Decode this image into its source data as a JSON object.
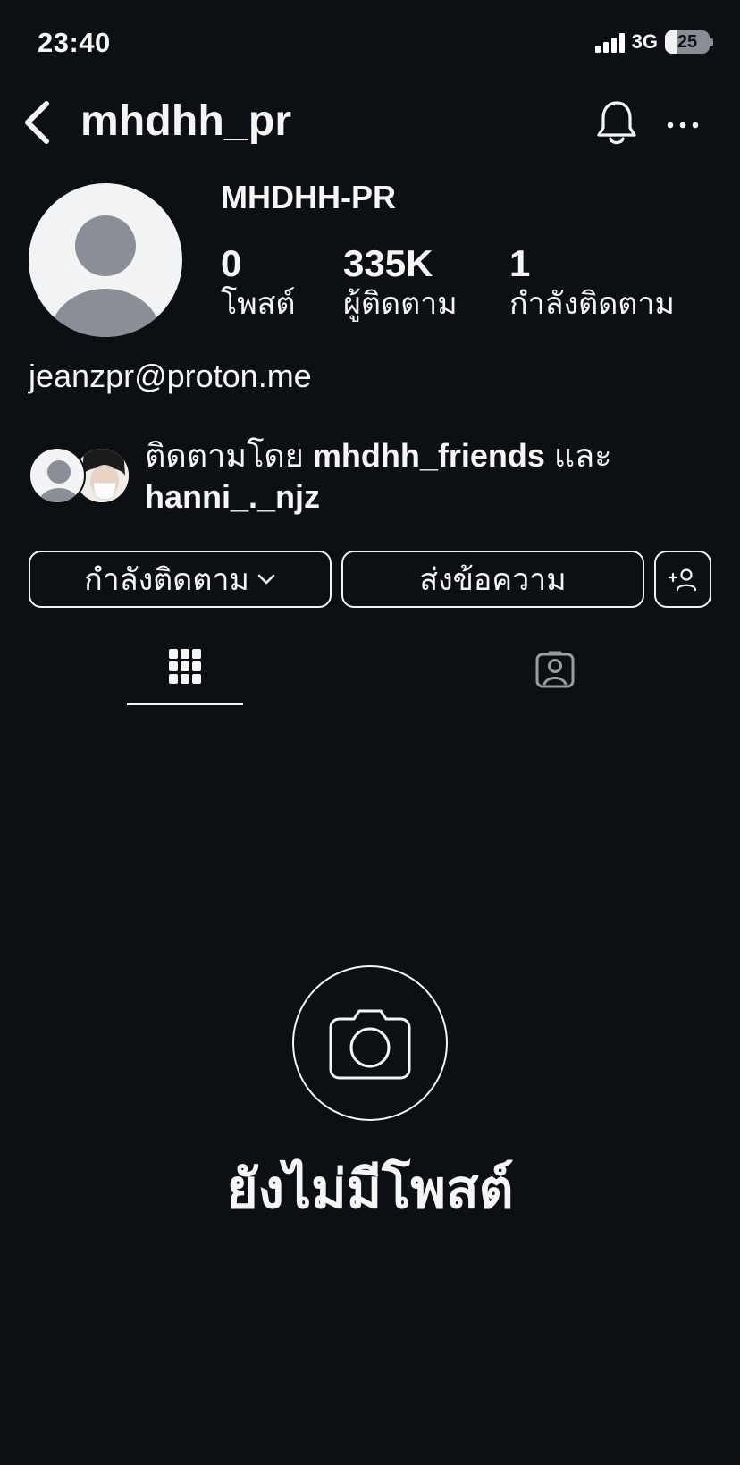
{
  "status_bar": {
    "time": "23:40",
    "network": "3G",
    "battery_level": "25",
    "battery_fraction": 0.25
  },
  "header": {
    "username": "mhdhh_pr",
    "back_icon": "chevron-left-icon",
    "bell_icon": "bell-icon",
    "more_icon": "more-horizontal-icon"
  },
  "profile": {
    "display_name": "MHDHH-PR",
    "stats": [
      {
        "value": "0",
        "label": "โพสต์"
      },
      {
        "value": "335K",
        "label": "ผู้ติดตาม"
      },
      {
        "value": "1",
        "label": "กำลังติดตาม"
      }
    ],
    "bio": "jeanzpr@proton.me",
    "followed_by": {
      "prefix": "ติดตามโดย ",
      "user1": "mhdhh_friends",
      "joiner": " และ",
      "user2": "hanni_._njz"
    }
  },
  "actions": {
    "following_label": "กำลังติดตาม",
    "message_label": "ส่งข้อความ",
    "add_user_icon": "add-user-icon"
  },
  "tabs": [
    {
      "name": "grid",
      "icon": "grid-icon",
      "active": true
    },
    {
      "name": "tagged",
      "icon": "tagged-person-icon",
      "active": false
    }
  ],
  "empty_state": {
    "icon": "camera-icon",
    "text": "ยังไม่มีโพสต์"
  },
  "colors": {
    "background": "#0c0f14",
    "text": "#f5f5f5",
    "inactive_icon": "#9a9ca2"
  }
}
